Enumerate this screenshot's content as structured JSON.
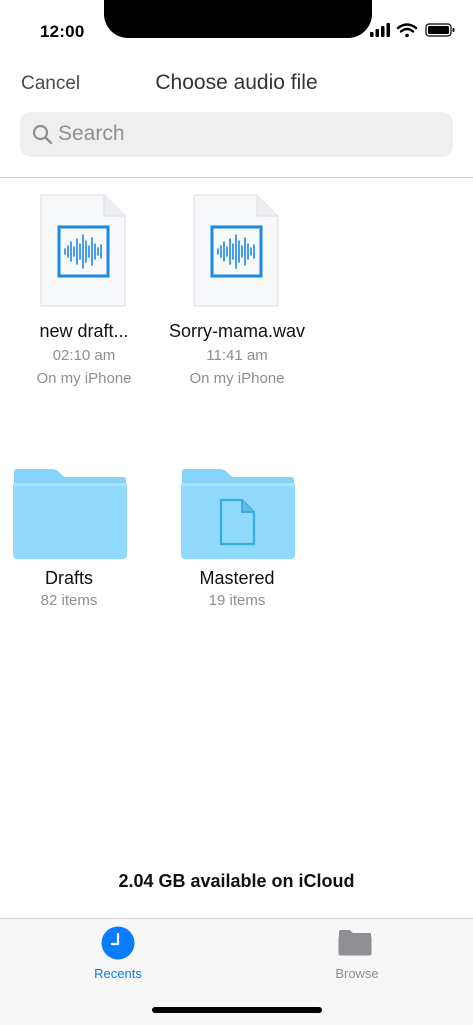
{
  "status_bar": {
    "time": "12:00"
  },
  "header": {
    "cancel_label": "Cancel",
    "title": "Choose audio file"
  },
  "search": {
    "placeholder": "Search"
  },
  "files": [
    {
      "name": "new draft...",
      "time": "02:10 am",
      "location": "On my iPhone",
      "icon": "audio-file-icon"
    },
    {
      "name": "Sorry-mama.wav",
      "time": "11:41 am",
      "location": "On my iPhone",
      "icon": "audio-file-icon"
    }
  ],
  "folders": [
    {
      "name": "Drafts",
      "count": "82 items",
      "icon": "folder-icon"
    },
    {
      "name": "Mastered",
      "count": "19 items",
      "icon": "folder-document-icon"
    }
  ],
  "storage_text": "2.04 GB available on iCloud",
  "tabs": [
    {
      "label": "Recents",
      "icon": "clock-icon",
      "active": true
    },
    {
      "label": "Browse",
      "icon": "folder-icon",
      "active": false
    }
  ],
  "colors": {
    "accent": "#0a7cff",
    "folder": "#7dd3fb",
    "waveform": "#1e88e5",
    "inactive": "#8e8e93"
  }
}
